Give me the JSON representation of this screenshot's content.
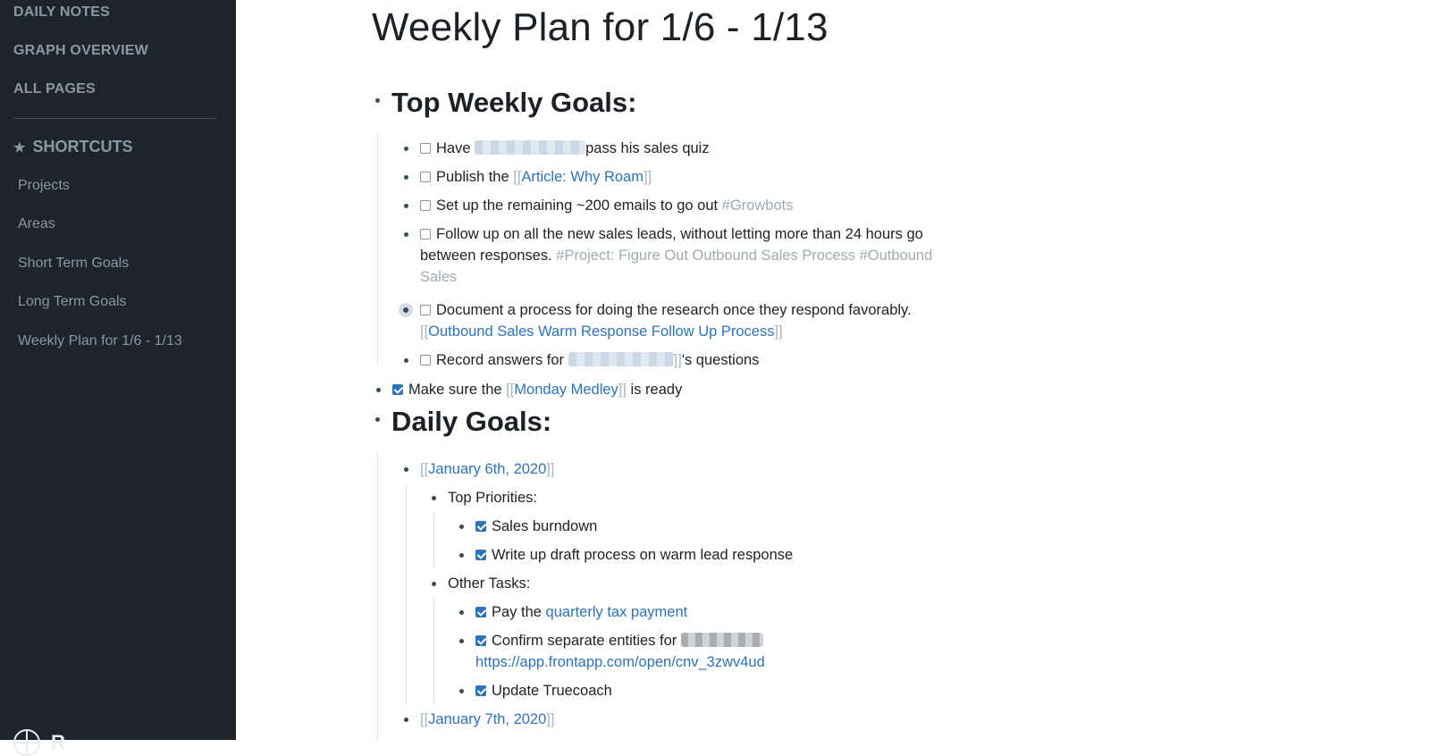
{
  "sidebar": {
    "nav": [
      "DAILY NOTES",
      "GRAPH OVERVIEW",
      "ALL PAGES"
    ],
    "shortcuts_label": "SHORTCUTS",
    "star_icon": "★",
    "shortcuts": [
      "Projects",
      "Areas",
      "Short Term Goals",
      "Long Term Goals",
      "Weekly Plan for 1/6 - 1/13"
    ],
    "brand": "R"
  },
  "page": {
    "title": "Weekly Plan for 1/6 - 1/13",
    "weekly_heading": "Top Weekly Goals:",
    "weekly": {
      "g1_pre": "Have ",
      "g1_post": "pass his sales quiz",
      "g2_pre": "Publish the ",
      "g2_link": "Article: Why Roam",
      "g3_text": "Set up the remaining ~200 emails to go out ",
      "g3_tag": "#Growbots",
      "g4_line1": "Follow up on all the new sales leads, without letting more than 24 hours go",
      "g4_line2": "between responses. ",
      "g4_tag1": "#Project: Figure Out Outbound Sales Process",
      "g4_tag2a": " #Outbound",
      "g4_tag2b": "Sales",
      "g5_line1": "Document a process for doing the research once they respond favorably.",
      "g5_link": "Outbound Sales Warm Response Follow Up Process",
      "g6_pre": "Record answers for ",
      "g6_post": "'s questions"
    },
    "medley_pre": "Make sure the ",
    "medley_link": "Monday Medley",
    "medley_post": " is ready",
    "daily_heading": "Daily Goals:",
    "day1_link": "January 6th, 2020",
    "top_priorities": "Top Priorities:",
    "tp1": "Sales burndown",
    "tp2": "Write up draft process on warm lead response",
    "other_tasks": "Other Tasks:",
    "ot1_pre": "Pay the ",
    "ot1_link": "quarterly tax payment",
    "ot2_pre": "Confirm separate entities for ",
    "ot2_url": "https://app.frontapp.com/open/cnv_3zwv4ud",
    "ot3": "Update Truecoach",
    "day2_link": "January 7th, 2020",
    "bracket_open": "[[",
    "bracket_close": "]]"
  }
}
